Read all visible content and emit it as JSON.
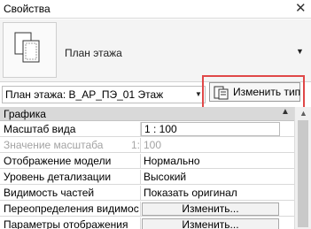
{
  "panel": {
    "title": "Свойства",
    "close_glyph": "✕"
  },
  "type_selector": {
    "name": "План этажа",
    "dropdown_glyph": "▼"
  },
  "view_selector": {
    "label": "План этажа: В_АР_ПЭ_01 Этаж",
    "dropdown_glyph": "▼"
  },
  "edit_type": {
    "label": "Изменить тип"
  },
  "group": {
    "title": "Графика",
    "collapse_glyph": "▲"
  },
  "properties": [
    {
      "name": "Масштаб вида",
      "value": "1 : 100"
    },
    {
      "name": "Значение масштаба",
      "suffix": "1:",
      "value": "100"
    },
    {
      "name": "Отображение модели",
      "value": "Нормально"
    },
    {
      "name": "Уровень детализации",
      "value": "Высокий"
    },
    {
      "name": "Видимость частей",
      "value": "Показать оригинал"
    },
    {
      "name": "Переопределения видимости",
      "value": "Изменить..."
    },
    {
      "name": "Параметры отображения",
      "value": "Изменить..."
    }
  ],
  "scroll_up_glyph": "▲"
}
